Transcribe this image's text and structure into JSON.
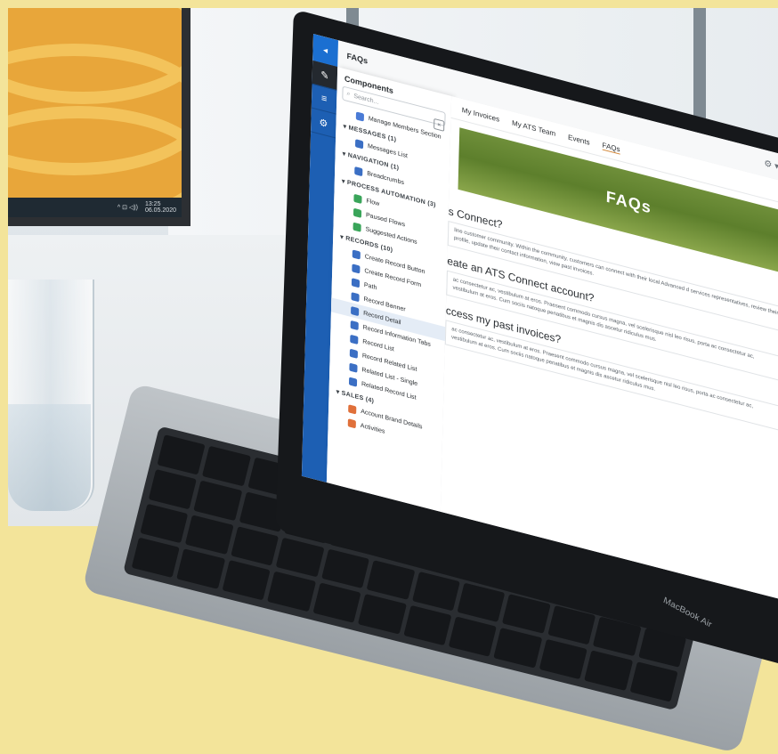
{
  "app": {
    "title": "FAQs",
    "logo_glyph": "◂",
    "gear_glyph": "⚙ ▾",
    "refresh_glyph": "↻"
  },
  "rail": [
    {
      "glyph": "✎",
      "active": true
    },
    {
      "glyph": "≡",
      "active": false
    },
    {
      "glyph": "⚙",
      "active": false
    }
  ],
  "components": {
    "title": "Components",
    "search_placeholder": "Search...",
    "close_glyph": "×",
    "sections": [
      {
        "label": "",
        "items": [
          {
            "label": "Manage Members Section",
            "color": "#4a7bd6"
          }
        ]
      },
      {
        "label": "MESSAGES (1)",
        "items": [
          {
            "label": "Messages List",
            "color": "#3b6fc4"
          }
        ]
      },
      {
        "label": "NAVIGATION (1)",
        "items": [
          {
            "label": "Breadcrumbs",
            "color": "#3b6fc4"
          }
        ]
      },
      {
        "label": "PROCESS AUTOMATION (3)",
        "items": [
          {
            "label": "Flow",
            "color": "#3aa55a"
          },
          {
            "label": "Paused Flows",
            "color": "#3aa55a"
          },
          {
            "label": "Suggested Actions",
            "color": "#3aa55a"
          }
        ]
      },
      {
        "label": "RECORDS (10)",
        "items": [
          {
            "label": "Create Record Button",
            "color": "#3b6fc4"
          },
          {
            "label": "Create Record Form",
            "color": "#3b6fc4"
          },
          {
            "label": "Path",
            "color": "#3b6fc4"
          },
          {
            "label": "Record Banner",
            "color": "#3b6fc4"
          },
          {
            "label": "Record Detail",
            "color": "#3b6fc4",
            "selected": true
          },
          {
            "label": "Record Information Tabs",
            "color": "#3b6fc4"
          },
          {
            "label": "Record List",
            "color": "#3b6fc4"
          },
          {
            "label": "Record Related List",
            "color": "#3b6fc4"
          },
          {
            "label": "Related List - Single",
            "color": "#3b6fc4"
          },
          {
            "label": "Related Record List",
            "color": "#3b6fc4"
          }
        ]
      },
      {
        "label": "SALES (4)",
        "items": [
          {
            "label": "Account Brand Details",
            "color": "#e0703a"
          },
          {
            "label": "Activities",
            "color": "#e0703a"
          }
        ]
      }
    ]
  },
  "navbar": {
    "items": [
      "My Invoices",
      "My ATS Team",
      "Events",
      "FAQs"
    ],
    "active_index": 3,
    "tools": "↶ ↷"
  },
  "hero": {
    "title": "FAQs"
  },
  "faqs": [
    {
      "question": "s Connect?",
      "answer": "line customer community. Within the community, customers can connect with their local Advanced d services representatives, review their profile, update their contact information, view past invoices."
    },
    {
      "question": "eate an ATS Connect account?",
      "answer": "ac consectetur ac, vestibulum at eros. Praesent commodo cursus magna, vel scelerisque nisl leo risus, porta ac consectetur ac, vestibulum at eros. Cum sociis natoque penatibus et magnis dis ascetur ridiculus mus."
    },
    {
      "question": "ccess my past invoices?",
      "answer": "ac consectetur ac, vestibulum at eros. Praesent commodo cursus magna, vel scelerisque nisl leo risus, porta ac consectetur ac, vestibulum at eros. Cum sociis natoque penatibus et magnis dis ascetur ridiculus mus."
    }
  ],
  "monitor": {
    "time": "13:25",
    "date": "06.05.2020",
    "tray": "^ ⊡ ◁))"
  },
  "laptop": {
    "brand": "MacBook Air"
  }
}
